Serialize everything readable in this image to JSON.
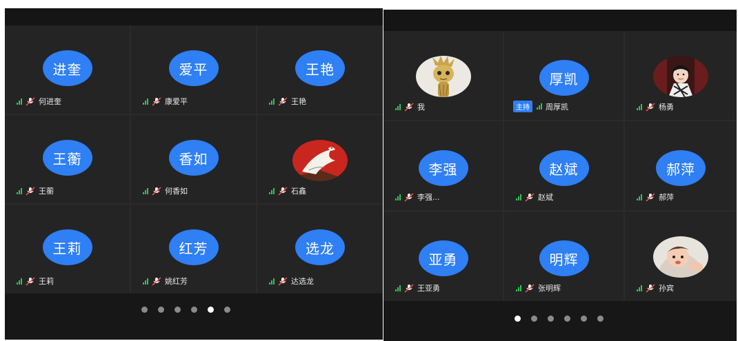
{
  "colors": {
    "accent": "#2f7ff5",
    "signal": "#34c25a",
    "tile_bg": "#242424",
    "panel_bg": "#171717"
  },
  "left_panel": {
    "participants": [
      {
        "avatar_text": "进奎",
        "name": "何进奎"
      },
      {
        "avatar_text": "爱平",
        "name": "康爱平"
      },
      {
        "avatar_text": "王艳",
        "name": "王艳"
      },
      {
        "avatar_text": "王蘅",
        "name": "王蘅"
      },
      {
        "avatar_text": "香如",
        "name": "何香如"
      },
      {
        "avatar_text": "",
        "name": "石鑫",
        "photo": "eagle-painting"
      },
      {
        "avatar_text": "王莉",
        "name": "王莉"
      },
      {
        "avatar_text": "红芳",
        "name": "姚红芳"
      },
      {
        "avatar_text": "选龙",
        "name": "达选龙"
      }
    ],
    "pagination": {
      "total": 6,
      "active_index": 4
    }
  },
  "right_panel": {
    "participants": [
      {
        "avatar_text": "",
        "name": "我",
        "photo": "groot-figure"
      },
      {
        "avatar_text": "厚凯",
        "name": "周厚凯",
        "badge": "主持"
      },
      {
        "avatar_text": "",
        "name": "杨勇",
        "photo": "child-portrait"
      },
      {
        "avatar_text": "李强",
        "name": "李强..."
      },
      {
        "avatar_text": "赵斌",
        "name": "赵斌"
      },
      {
        "avatar_text": "郝萍",
        "name": "郝萍"
      },
      {
        "avatar_text": "亚勇",
        "name": "王亚勇"
      },
      {
        "avatar_text": "明辉",
        "name": "张明辉"
      },
      {
        "avatar_text": "",
        "name": "孙宾",
        "photo": "baby-portrait"
      }
    ],
    "pagination": {
      "total": 6,
      "active_index": 0
    }
  }
}
